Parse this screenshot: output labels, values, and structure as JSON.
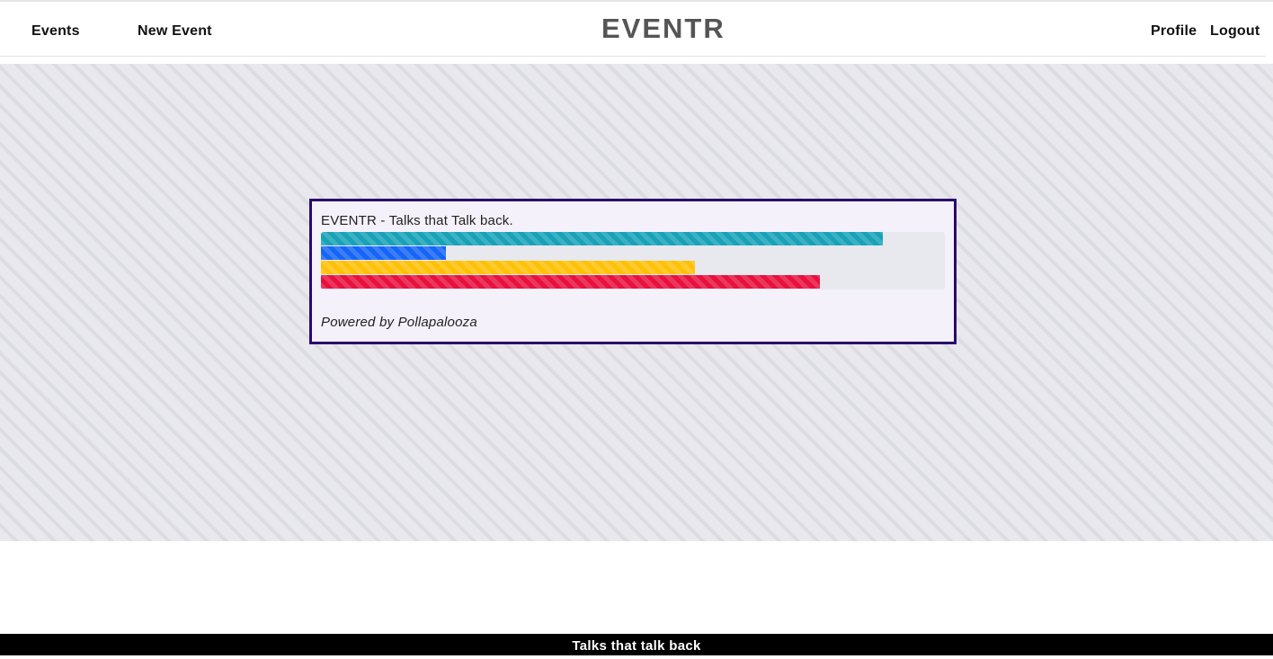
{
  "nav": {
    "events_label": "Events",
    "new_event_label": "New Event",
    "brand": "EVENTR",
    "profile_label": "Profile",
    "logout_label": "Logout"
  },
  "poll": {
    "title": "EVENTR - Talks that Talk back.",
    "powered_by": "Powered by Pollapalooza",
    "results": [
      {
        "fraction": 0.9,
        "color": "#17a2b8"
      },
      {
        "fraction": 0.2,
        "color": "#1565f6"
      },
      {
        "fraction": 0.6,
        "color": "#ffc107"
      },
      {
        "fraction": 0.8,
        "color": "#e8113e"
      }
    ]
  },
  "footer": {
    "text": "Talks that talk back"
  }
}
